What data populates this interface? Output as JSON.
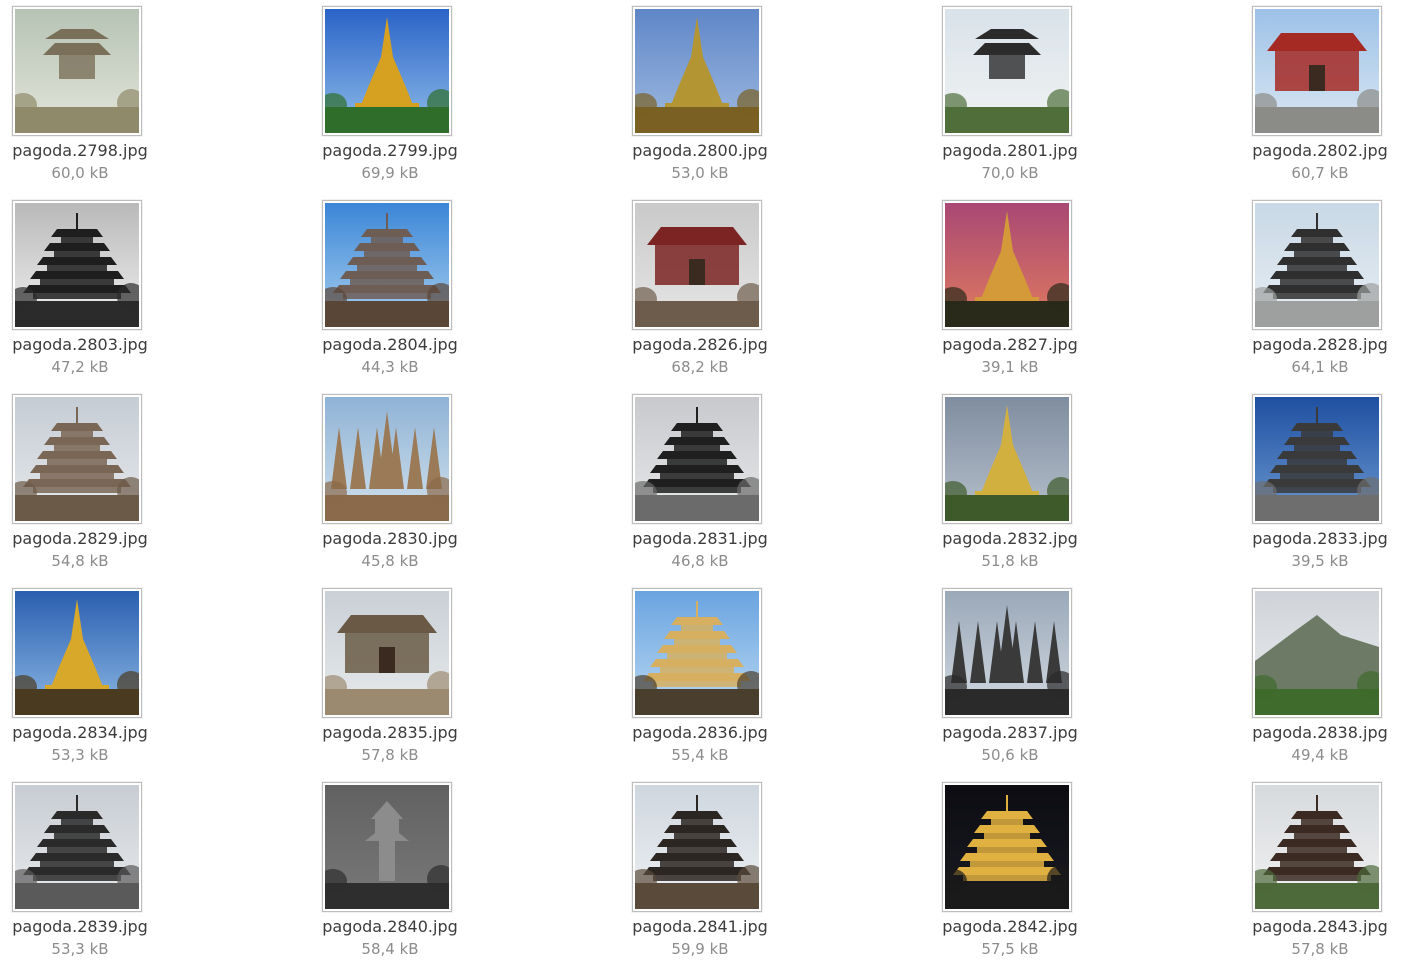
{
  "file_manager": {
    "files": [
      {
        "name": "pagoda.2798.jpg",
        "size": "60,0 kB",
        "thumb": {
          "sky_top": "#b6c3b4",
          "sky_bottom": "#e3e6da",
          "ground": "#8f8a6a",
          "structure": "#7a705a",
          "icon": "park-pavilion-photo-icon"
        }
      },
      {
        "name": "pagoda.2799.jpg",
        "size": "69,9 kB",
        "thumb": {
          "sky_top": "#2a63c8",
          "sky_bottom": "#8fbde8",
          "ground": "#2f6d2b",
          "structure": "#d6a020",
          "icon": "golden-stupa-photo-icon"
        }
      },
      {
        "name": "pagoda.2800.jpg",
        "size": "53,0 kB",
        "thumb": {
          "sky_top": "#5f86c8",
          "sky_bottom": "#9fbbe0",
          "ground": "#7a6022",
          "structure": "#b49533",
          "icon": "golden-stupa-photo-icon"
        }
      },
      {
        "name": "pagoda.2801.jpg",
        "size": "70,0 kB",
        "thumb": {
          "sky_top": "#d9e2ea",
          "sky_bottom": "#f1f3f2",
          "ground": "#4f6e3a",
          "structure": "#2b2b2b",
          "icon": "chinese-pavilion-photo-icon"
        }
      },
      {
        "name": "pagoda.2802.jpg",
        "size": "60,7 kB",
        "thumb": {
          "sky_top": "#9dc1e8",
          "sky_bottom": "#dbe8f2",
          "ground": "#8b8b88",
          "structure": "#a52a24",
          "icon": "red-temple-gate-photo-icon"
        }
      },
      {
        "name": "pagoda.2803.jpg",
        "size": "47,2 kB",
        "thumb": {
          "sky_top": "#b9b9b9",
          "sky_bottom": "#f0f0f0",
          "ground": "#2b2b2b",
          "structure": "#1e1e1e",
          "icon": "tiered-pagoda-photo-icon"
        }
      },
      {
        "name": "pagoda.2804.jpg",
        "size": "44,3 kB",
        "thumb": {
          "sky_top": "#3b86d6",
          "sky_bottom": "#a9d0f0",
          "ground": "#5a4637",
          "structure": "#6e5d55",
          "icon": "tiered-pagoda-photo-icon"
        }
      },
      {
        "name": "pagoda.2826.jpg",
        "size": "68,2 kB",
        "thumb": {
          "sky_top": "#c9c9c9",
          "sky_bottom": "#e6e6e6",
          "ground": "#6d5c4c",
          "structure": "#7c2424",
          "icon": "ornate-temple-photo-icon"
        }
      },
      {
        "name": "pagoda.2827.jpg",
        "size": "39,1 kB",
        "thumb": {
          "sky_top": "#a94874",
          "sky_bottom": "#e07b5f",
          "ground": "#2a2a1a",
          "structure": "#d49a3a",
          "icon": "golden-stupa-photo-icon"
        }
      },
      {
        "name": "pagoda.2828.jpg",
        "size": "64,1 kB",
        "thumb": {
          "sky_top": "#c8d8e6",
          "sky_bottom": "#e8eef2",
          "ground": "#9ea0a0",
          "structure": "#2f2f2f",
          "icon": "tiered-pagoda-photo-icon"
        }
      },
      {
        "name": "pagoda.2829.jpg",
        "size": "54,8 kB",
        "thumb": {
          "sky_top": "#c5ccd4",
          "sky_bottom": "#e6e9ec",
          "ground": "#6c5a48",
          "structure": "#7a6655",
          "icon": "tiered-pagoda-photo-icon"
        }
      },
      {
        "name": "pagoda.2830.jpg",
        "size": "45,8 kB",
        "thumb": {
          "sky_top": "#8fb3d6",
          "sky_bottom": "#d2e1ec",
          "ground": "#8a6a4a",
          "structure": "#9b7a58",
          "icon": "stone-spire-photo-icon"
        }
      },
      {
        "name": "pagoda.2831.jpg",
        "size": "46,8 kB",
        "thumb": {
          "sky_top": "#c7c9cc",
          "sky_bottom": "#e7e8ea",
          "ground": "#6b6b6b",
          "structure": "#1f1f1f",
          "icon": "tiered-pagoda-photo-icon"
        }
      },
      {
        "name": "pagoda.2832.jpg",
        "size": "51,8 kB",
        "thumb": {
          "sky_top": "#7f8da0",
          "sky_bottom": "#b7c1cc",
          "ground": "#3e5a2a",
          "structure": "#d2b040",
          "icon": "golden-stupa-photo-icon"
        }
      },
      {
        "name": "pagoda.2833.jpg",
        "size": "39,5 kB",
        "thumb": {
          "sky_top": "#1f4fa0",
          "sky_bottom": "#6c9ad2",
          "ground": "#6e6e6e",
          "structure": "#3a3a3a",
          "icon": "tiered-pagoda-photo-icon"
        }
      },
      {
        "name": "pagoda.2834.jpg",
        "size": "53,3 kB",
        "thumb": {
          "sky_top": "#2a5fb0",
          "sky_bottom": "#8db8e4",
          "ground": "#4a3a20",
          "structure": "#d8a82a",
          "icon": "golden-stupa-photo-icon"
        }
      },
      {
        "name": "pagoda.2835.jpg",
        "size": "57,8 kB",
        "thumb": {
          "sky_top": "#c9d0d6",
          "sky_bottom": "#e7eaec",
          "ground": "#9c8a70",
          "structure": "#6a5a45",
          "icon": "temple-courtyard-photo-icon"
        }
      },
      {
        "name": "pagoda.2836.jpg",
        "size": "55,4 kB",
        "thumb": {
          "sky_top": "#6aa4e0",
          "sky_bottom": "#bad8f2",
          "ground": "#4a3f2e",
          "structure": "#d6b060",
          "icon": "tiered-pagoda-photo-icon"
        }
      },
      {
        "name": "pagoda.2837.jpg",
        "size": "50,6 kB",
        "thumb": {
          "sky_top": "#9aa8b8",
          "sky_bottom": "#d3dae2",
          "ground": "#2a2a2a",
          "structure": "#3a3a3a",
          "icon": "spire-cluster-photo-icon"
        }
      },
      {
        "name": "pagoda.2838.jpg",
        "size": "49,4 kB",
        "thumb": {
          "sky_top": "#cfd3d8",
          "sky_bottom": "#eceef0",
          "ground": "#3f6b2c",
          "structure": "#6d7a66",
          "icon": "mountain-forest-photo-icon"
        }
      },
      {
        "name": "pagoda.2839.jpg",
        "size": "53,3 kB",
        "thumb": {
          "sky_top": "#c8cdd3",
          "sky_bottom": "#e8eaec",
          "ground": "#5a5a5a",
          "structure": "#2a2a2a",
          "icon": "street-pagoda-photo-icon"
        }
      },
      {
        "name": "pagoda.2840.jpg",
        "size": "58,4 kB",
        "thumb": {
          "sky_top": "#6c6c6c",
          "sky_bottom": "#a8a8a8",
          "ground": "#2e2e2e",
          "structure": "#8c8c8c",
          "icon": "stone-lantern-photo-icon"
        }
      },
      {
        "name": "pagoda.2841.jpg",
        "size": "59,9 kB",
        "thumb": {
          "sky_top": "#cfd6de",
          "sky_bottom": "#eef1f4",
          "ground": "#5a4a3a",
          "structure": "#2c2622",
          "icon": "tiered-pagoda-photo-icon"
        }
      },
      {
        "name": "pagoda.2842.jpg",
        "size": "57,5 kB",
        "thumb": {
          "sky_top": "#0c0c12",
          "sky_bottom": "#1a1a22",
          "ground": "#1a1a1a",
          "structure": "#e0b040",
          "icon": "illuminated-pagoda-photo-icon"
        }
      },
      {
        "name": "pagoda.2843.jpg",
        "size": "57,8 kB",
        "thumb": {
          "sky_top": "#d7dadd",
          "sky_bottom": "#f0f1f2",
          "ground": "#4d6a3a",
          "structure": "#3a2a22",
          "icon": "tiered-pagoda-photo-icon"
        }
      }
    ]
  }
}
